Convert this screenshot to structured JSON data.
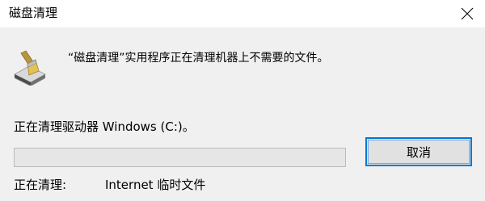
{
  "window": {
    "title": "磁盘清理"
  },
  "icons": {
    "close": "close-icon",
    "app": "disk-cleanup-icon"
  },
  "message": "“磁盘清理”实用程序正在清理机器上不需要的文件。",
  "drive_status": "正在清理驱动器 Windows (C:)。",
  "progress": {
    "percent": 0
  },
  "buttons": {
    "cancel_label": "取消"
  },
  "status": {
    "cleaning_label": "正在清理:",
    "cleaning_item": "Internet 临时文件"
  },
  "colors": {
    "accent": "#0078d7",
    "progress_fill": "#06b025"
  }
}
